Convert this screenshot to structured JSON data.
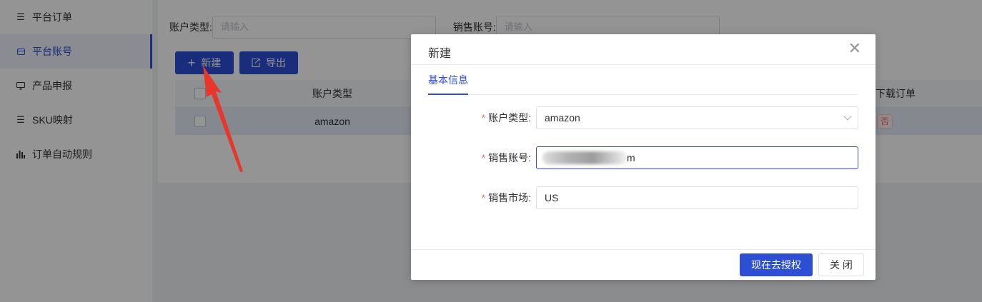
{
  "sidebar": {
    "items": [
      {
        "label": "平台订单",
        "icon": "list-icon"
      },
      {
        "label": "平台账号",
        "icon": "card-icon"
      },
      {
        "label": "产品申报",
        "icon": "monitor-icon"
      },
      {
        "label": "SKU映射",
        "icon": "list-icon"
      },
      {
        "label": "订单自动规则",
        "icon": "bar-chart-icon"
      }
    ]
  },
  "filters": {
    "account_type_label": "账户类型:",
    "account_type_placeholder": "请输入",
    "sales_account_label": "销售账号:",
    "sales_account_placeholder": "请输入"
  },
  "toolbar": {
    "new_label": "新建",
    "export_label": "导出"
  },
  "table": {
    "headers": [
      "账户类型",
      "下载订单"
    ],
    "rows": [
      {
        "account_type": "amazon",
        "download_orders": "否"
      }
    ]
  },
  "dialog": {
    "title": "新建",
    "tab": "基本信息",
    "fields": {
      "account_type": {
        "label": "账户类型:",
        "value": "amazon"
      },
      "sales_account": {
        "label": "销售账号:",
        "value_suffix": "m"
      },
      "sales_market": {
        "label": "销售市场:",
        "value": "US"
      }
    },
    "authorize_button": "现在去授权",
    "close_button": "关 闭"
  },
  "colors": {
    "primary": "#2d4fd6",
    "required_star": "#f56c6c",
    "annotation_arrow": "#e8362b"
  }
}
